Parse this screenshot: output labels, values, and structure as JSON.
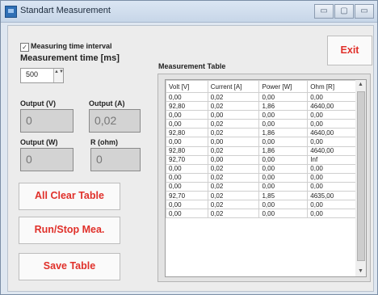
{
  "window": {
    "title": "Standart Measurement",
    "minimize": "▭",
    "maximize": "▢",
    "close": "▭"
  },
  "settings": {
    "checkbox_label": "Measuring time interval",
    "checkbox_checked": true,
    "checkmark": "✓",
    "time_label": "Measurement time [ms]",
    "time_value": "500",
    "spin_arrows": "▲▼"
  },
  "outputs": {
    "voltage_label": "Output (V)",
    "voltage_value": "0",
    "current_label": "Output (A)",
    "current_value": "0,02",
    "power_label": "Output (W)",
    "power_value": "0",
    "resistance_label": "R (ohm)",
    "resistance_value": "0"
  },
  "buttons": {
    "clear_label": "All Clear Table",
    "run_label": "Run/Stop Mea.",
    "save_label": "Save Table",
    "exit_label": "Exit"
  },
  "table": {
    "title": "Measurement Table",
    "columns": [
      "Volt [V]",
      "Current [A]",
      "Power [W]",
      "Ohm [R]"
    ],
    "rows": [
      [
        "0,00",
        "0,02",
        "0,00",
        "0,00"
      ],
      [
        "92,80",
        "0,02",
        "1,86",
        "4640,00"
      ],
      [
        "0,00",
        "0,00",
        "0,00",
        "0,00"
      ],
      [
        "0,00",
        "0,02",
        "0,00",
        "0,00"
      ],
      [
        "92,80",
        "0,02",
        "1,86",
        "4640,00"
      ],
      [
        "0,00",
        "0,00",
        "0,00",
        "0,00"
      ],
      [
        "92,80",
        "0,02",
        "1,86",
        "4640,00"
      ],
      [
        "92,70",
        "0,00",
        "0,00",
        "Inf"
      ],
      [
        "0,00",
        "0,02",
        "0,00",
        "0,00"
      ],
      [
        "0,00",
        "0,02",
        "0,00",
        "0,00"
      ],
      [
        "0,00",
        "0,02",
        "0,00",
        "0,00"
      ],
      [
        "92,70",
        "0,02",
        "1,85",
        "4635,00"
      ],
      [
        "0,00",
        "0,02",
        "0,00",
        "0,00"
      ],
      [
        "0,00",
        "0,02",
        "0,00",
        "0,00"
      ]
    ]
  },
  "scrollbar": {
    "up": "▲",
    "down": "▼"
  },
  "colors": {
    "accent_red": "#e0302a",
    "titlebar": "#c7d6e8"
  }
}
